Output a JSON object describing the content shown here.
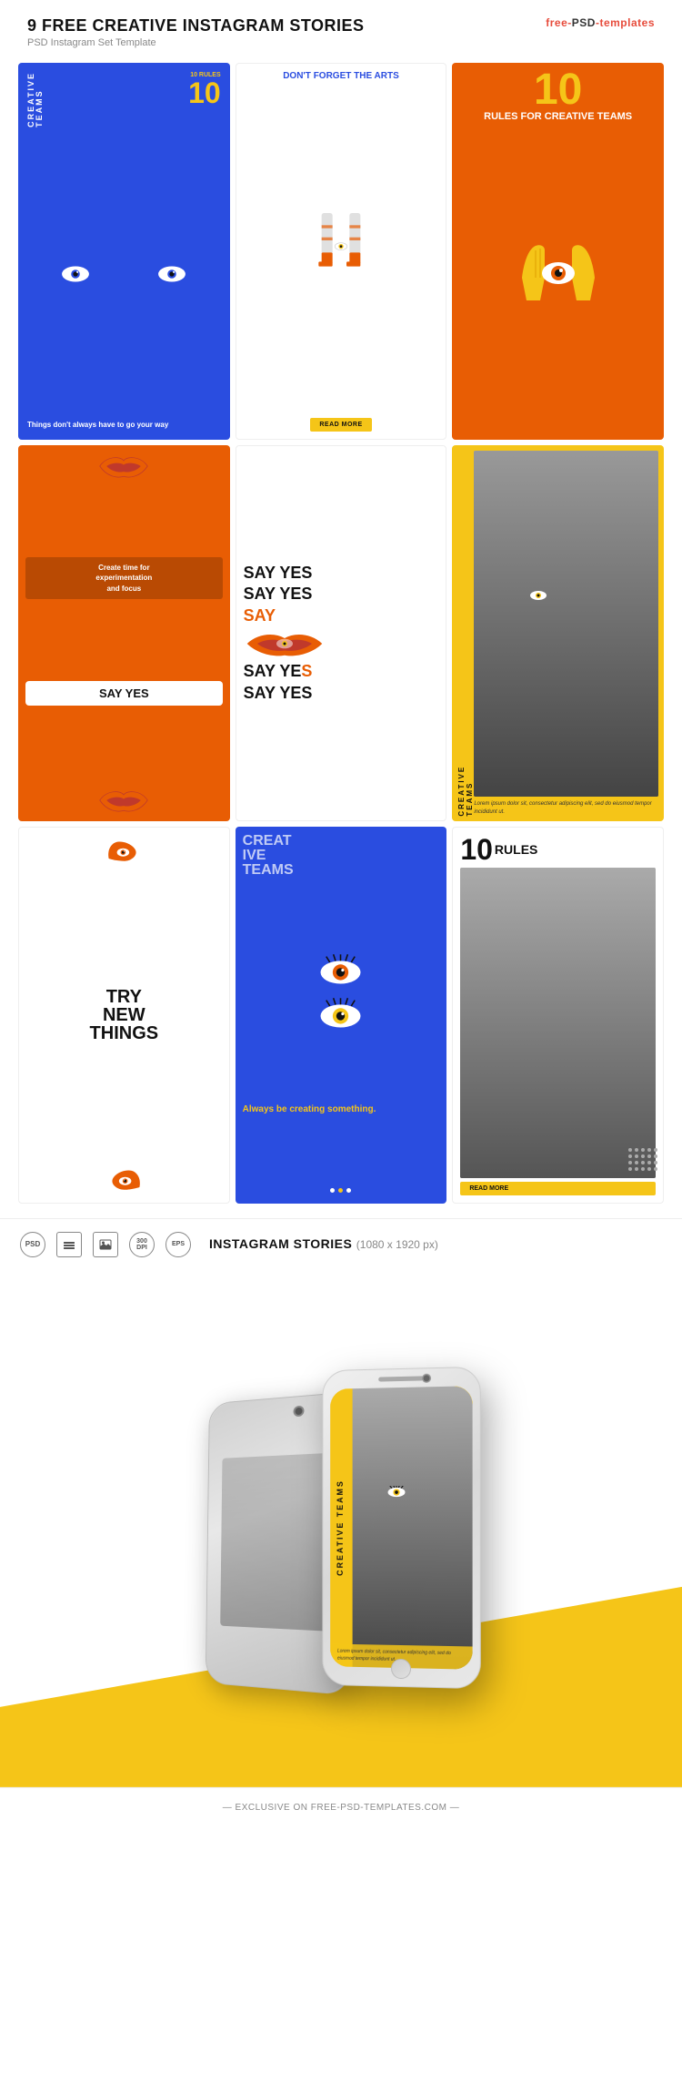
{
  "header": {
    "title": "9 FREE CREATIVE INSTAGRAM STORIES",
    "subtitle": "PSD Instagram Set Template",
    "brand": {
      "prefix": "free-",
      "middle": "PSD",
      "suffix": "-templates"
    }
  },
  "cards": [
    {
      "id": 1,
      "bg": "#2a4de0",
      "label_vert": "CREATIVE TEAMS",
      "rules_label": "10 RULES",
      "big_number": "10",
      "bottom_text": "Things don't always have to go your way"
    },
    {
      "id": 2,
      "bg": "#ffffff",
      "title": "DON'T FORGET THE ARTS",
      "cta": "READ MORE"
    },
    {
      "id": 3,
      "bg": "#e85d04",
      "big_number": "10",
      "title": "RULES FOR CREATIVE TEAMS"
    },
    {
      "id": 4,
      "bg": "#e85d04",
      "body_text": "Create time for experimentation and focus",
      "cta": "SAY YES"
    },
    {
      "id": 5,
      "bg": "#ffffff",
      "lines": [
        "SAY YES",
        "SAY YES",
        "SAY",
        "SAY YES",
        "SAY YES"
      ]
    },
    {
      "id": 6,
      "bg": "#f5c518",
      "label_vert": "CREATIVE TEAMS",
      "lorem": "Lorem ipsum dolor sit, consectetur adipiscing elit, sed do eiusmod tempor incididunt ut."
    },
    {
      "id": 7,
      "bg": "#ffffff",
      "title": "TRY NEW THINGS"
    },
    {
      "id": 8,
      "bg": "#2a4de0",
      "title": "CREATIVE TEAMS",
      "body_text": "Always be creating something."
    },
    {
      "id": 9,
      "bg": "#ffffff",
      "big_number": "10",
      "title": "RULES",
      "cta": "READ MORE"
    }
  ],
  "specs": {
    "badges": [
      "PSD",
      "◉",
      "⬜",
      "300 DPI",
      "EPS"
    ],
    "label": "INSTAGRAM STORIES",
    "dimensions": "(1080 x 1920 px)"
  },
  "mockup": {
    "lorem": "Lorem ipsum dolor sit, consectetur adipiscing elit, sed do eiusmod tempor incididunt ut."
  },
  "footer": {
    "text": "— EXCLUSIVE ON FREE-PSD-TEMPLATES.COM —"
  }
}
